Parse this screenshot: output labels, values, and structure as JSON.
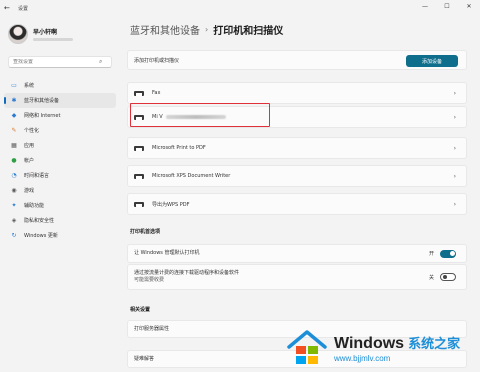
{
  "window": {
    "title": "设置",
    "back_glyph": "←",
    "controls": [
      "—",
      "☐",
      "✕"
    ]
  },
  "profile": {
    "name": "早小轩啊"
  },
  "search": {
    "placeholder": "查找设置",
    "value": ""
  },
  "sidebar": {
    "items": [
      {
        "label": "系统",
        "icon": "system-icon",
        "glyph": "▭",
        "color": "#2b7bd1",
        "active": false
      },
      {
        "label": "蓝牙和其他设备",
        "icon": "bluetooth-icon",
        "glyph": "✱",
        "color": "#2b7bd1",
        "active": true
      },
      {
        "label": "网络和 Internet",
        "icon": "network-icon",
        "glyph": "◆",
        "color": "#2b7bd1",
        "active": false
      },
      {
        "label": "个性化",
        "icon": "brush-icon",
        "glyph": "✎",
        "color": "#d97a2b",
        "active": false
      },
      {
        "label": "应用",
        "icon": "apps-icon",
        "glyph": "▦",
        "color": "#5a5a5a",
        "active": false
      },
      {
        "label": "帐户",
        "icon": "account-icon",
        "glyph": "●",
        "color": "#2ea043",
        "active": false
      },
      {
        "label": "时间和语言",
        "icon": "clock-globe-icon",
        "glyph": "◔",
        "color": "#2b7bd1",
        "active": false
      },
      {
        "label": "游戏",
        "icon": "gamepad-icon",
        "glyph": "◉",
        "color": "#5a5a5a",
        "active": false
      },
      {
        "label": "辅助功能",
        "icon": "accessibility-icon",
        "glyph": "✦",
        "color": "#2b7bd1",
        "active": false
      },
      {
        "label": "隐私和安全性",
        "icon": "shield-icon",
        "glyph": "◈",
        "color": "#5a5a5a",
        "active": false
      },
      {
        "label": "Windows 更新",
        "icon": "update-icon",
        "glyph": "↻",
        "color": "#2b7bd1",
        "active": false
      }
    ]
  },
  "breadcrumb": {
    "parent": "蓝牙和其他设备",
    "separator": "›",
    "current": "打印机和扫描仪"
  },
  "add_printer": {
    "label": "添加打印机或扫描仪",
    "button": "添加设备"
  },
  "printers": [
    {
      "label": "Fax"
    },
    {
      "label": "Mi V",
      "obscured": true
    },
    {
      "label": "Microsoft Print to PDF"
    },
    {
      "label": "Microsoft XPS Document Writer"
    },
    {
      "label": "导出为WPS PDF"
    }
  ],
  "chevron": "›",
  "preferences": {
    "heading": "打印机首选项",
    "items": [
      {
        "label": "让 Windows 管理默认打印机",
        "state": "开",
        "on": true
      },
      {
        "label": "通过按流量计费的连接下载驱动程序和设备软件",
        "sublabel": "可能需要收费",
        "state": "关",
        "on": false
      }
    ]
  },
  "related": {
    "heading": "相关设置",
    "items": [
      {
        "label": "打印服务器属性"
      },
      {
        "label": "疑难解答"
      }
    ]
  },
  "watermark": {
    "brand": "Windows",
    "brand_cn": "系统之家",
    "url": "www.bjjmlv.com"
  }
}
